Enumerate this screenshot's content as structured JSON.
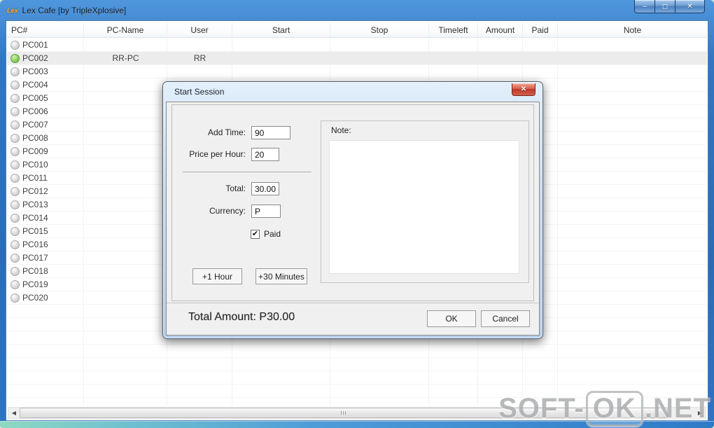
{
  "window": {
    "title": "Lex Cafe [by TripleXplosive]",
    "icon_label": "Lex",
    "controls": {
      "minimize_glyph": "–",
      "maximize_glyph": "◻",
      "close_glyph": "✕"
    }
  },
  "table": {
    "columns": [
      "PC#",
      "PC-Name",
      "User",
      "Start",
      "Stop",
      "Timeleft",
      "Amount",
      "Paid",
      "Note"
    ],
    "rows": [
      {
        "pc": "PC001",
        "name": "",
        "user": "",
        "status": "off"
      },
      {
        "pc": "PC002",
        "name": "RR-PC",
        "user": "RR",
        "status": "on",
        "selected": true
      },
      {
        "pc": "PC003",
        "name": "",
        "user": "",
        "status": "off"
      },
      {
        "pc": "PC004",
        "name": "",
        "user": "",
        "status": "off"
      },
      {
        "pc": "PC005",
        "name": "",
        "user": "",
        "status": "off"
      },
      {
        "pc": "PC006",
        "name": "",
        "user": "",
        "status": "off"
      },
      {
        "pc": "PC007",
        "name": "",
        "user": "",
        "status": "off"
      },
      {
        "pc": "PC008",
        "name": "",
        "user": "",
        "status": "off"
      },
      {
        "pc": "PC009",
        "name": "",
        "user": "",
        "status": "off"
      },
      {
        "pc": "PC010",
        "name": "",
        "user": "",
        "status": "off"
      },
      {
        "pc": "PC011",
        "name": "",
        "user": "",
        "status": "off"
      },
      {
        "pc": "PC012",
        "name": "",
        "user": "",
        "status": "off"
      },
      {
        "pc": "PC013",
        "name": "",
        "user": "",
        "status": "off"
      },
      {
        "pc": "PC014",
        "name": "",
        "user": "",
        "status": "off"
      },
      {
        "pc": "PC015",
        "name": "",
        "user": "",
        "status": "off"
      },
      {
        "pc": "PC016",
        "name": "",
        "user": "",
        "status": "off"
      },
      {
        "pc": "PC017",
        "name": "",
        "user": "",
        "status": "off"
      },
      {
        "pc": "PC018",
        "name": "",
        "user": "",
        "status": "off"
      },
      {
        "pc": "PC019",
        "name": "",
        "user": "",
        "status": "off"
      },
      {
        "pc": "PC020",
        "name": "",
        "user": "",
        "status": "off"
      }
    ]
  },
  "dialog": {
    "title": "Start Session",
    "close_glyph": "✕",
    "fields": {
      "add_time_label": "Add Time:",
      "add_time_value": "90",
      "price_per_hour_label": "Price per Hour:",
      "price_per_hour_value": "20",
      "total_label": "Total:",
      "total_value": "30.00",
      "currency_label": "Currency:",
      "currency_value": "P",
      "paid_label": "Paid",
      "paid_checked": true,
      "paid_glyph": "✔"
    },
    "buttons": {
      "add_hour": "+1 Hour",
      "add_30min": "+30 Minutes",
      "ok": "OK",
      "cancel": "Cancel"
    },
    "note_label": "Note:",
    "note_value": "",
    "total_amount_text": "Total Amount: P30.00"
  },
  "scrollbar": {
    "left_arrow_glyph": "◀",
    "right_arrow_glyph": "▶"
  },
  "watermark": {
    "part1": "SOFT-",
    "part2": "OK",
    "part3": ".NET"
  },
  "colors": {
    "titlebar_blue": "#2e74c4",
    "frame_teal": "#8ed9c2",
    "dialog_close_red": "#bb3826",
    "active_green": "#62b23e",
    "selected_row": "#ececec",
    "dialog_body": "#f0f0f0",
    "watermark_gray": "#abaeb0"
  }
}
